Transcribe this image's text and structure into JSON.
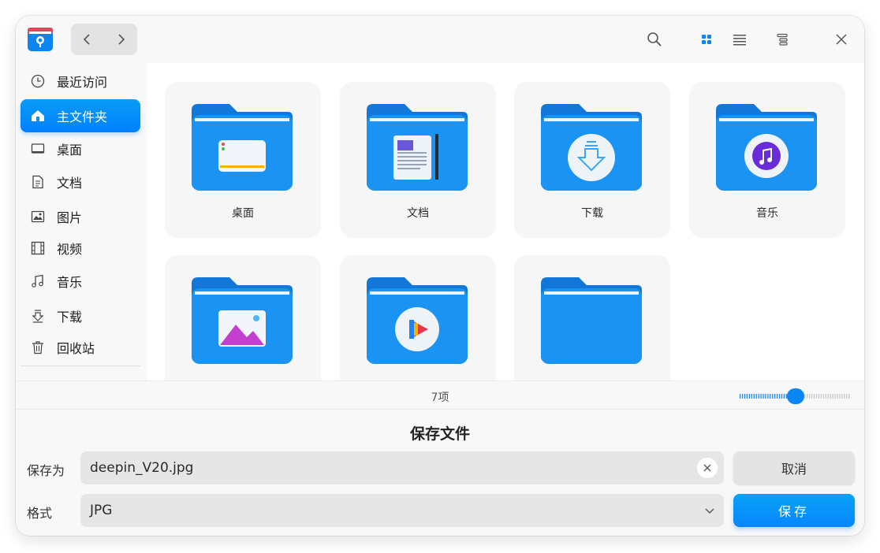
{
  "window": {
    "title_icon": "file-manager-icon",
    "accent": "#0a8ff8"
  },
  "toolbar": {
    "back_icon": "chevron-left-icon",
    "forward_icon": "chevron-right-icon",
    "search_icon": "search-icon",
    "view_modes": [
      "grid-view-icon",
      "list-view-icon",
      "tree-view-icon"
    ],
    "active_view": "grid-view-icon",
    "close_icon": "close-icon"
  },
  "sidebar": {
    "items": [
      {
        "label": "最近访问",
        "icon": "clock-icon"
      },
      {
        "label": "主文件夹",
        "icon": "home-icon",
        "active": true
      },
      {
        "label": "桌面",
        "icon": "desktop-icon"
      },
      {
        "label": "文档",
        "icon": "document-icon"
      },
      {
        "label": "图片",
        "icon": "picture-icon"
      },
      {
        "label": "视频",
        "icon": "video-icon"
      },
      {
        "label": "音乐",
        "icon": "music-icon"
      },
      {
        "label": "下载",
        "icon": "download-icon"
      },
      {
        "label": "回收站",
        "icon": "trash-icon"
      }
    ]
  },
  "folders": [
    {
      "label": "桌面",
      "emblem": "desktop-emblem"
    },
    {
      "label": "文档",
      "emblem": "document-emblem"
    },
    {
      "label": "下载",
      "emblem": "download-emblem"
    },
    {
      "label": "音乐",
      "emblem": "music-emblem"
    },
    {
      "label": "",
      "emblem": "picture-emblem"
    },
    {
      "label": "",
      "emblem": "video-emblem"
    },
    {
      "label": "",
      "emblem": "none"
    }
  ],
  "status": {
    "count_text": "7项",
    "zoom_level": 0.55
  },
  "save_dialog": {
    "title": "保存文件",
    "save_as_label": "保存为",
    "filename": "deepin_V20.jpg",
    "format_label": "格式",
    "format_value": "JPG",
    "cancel_label": "取消",
    "save_label": "保存"
  }
}
